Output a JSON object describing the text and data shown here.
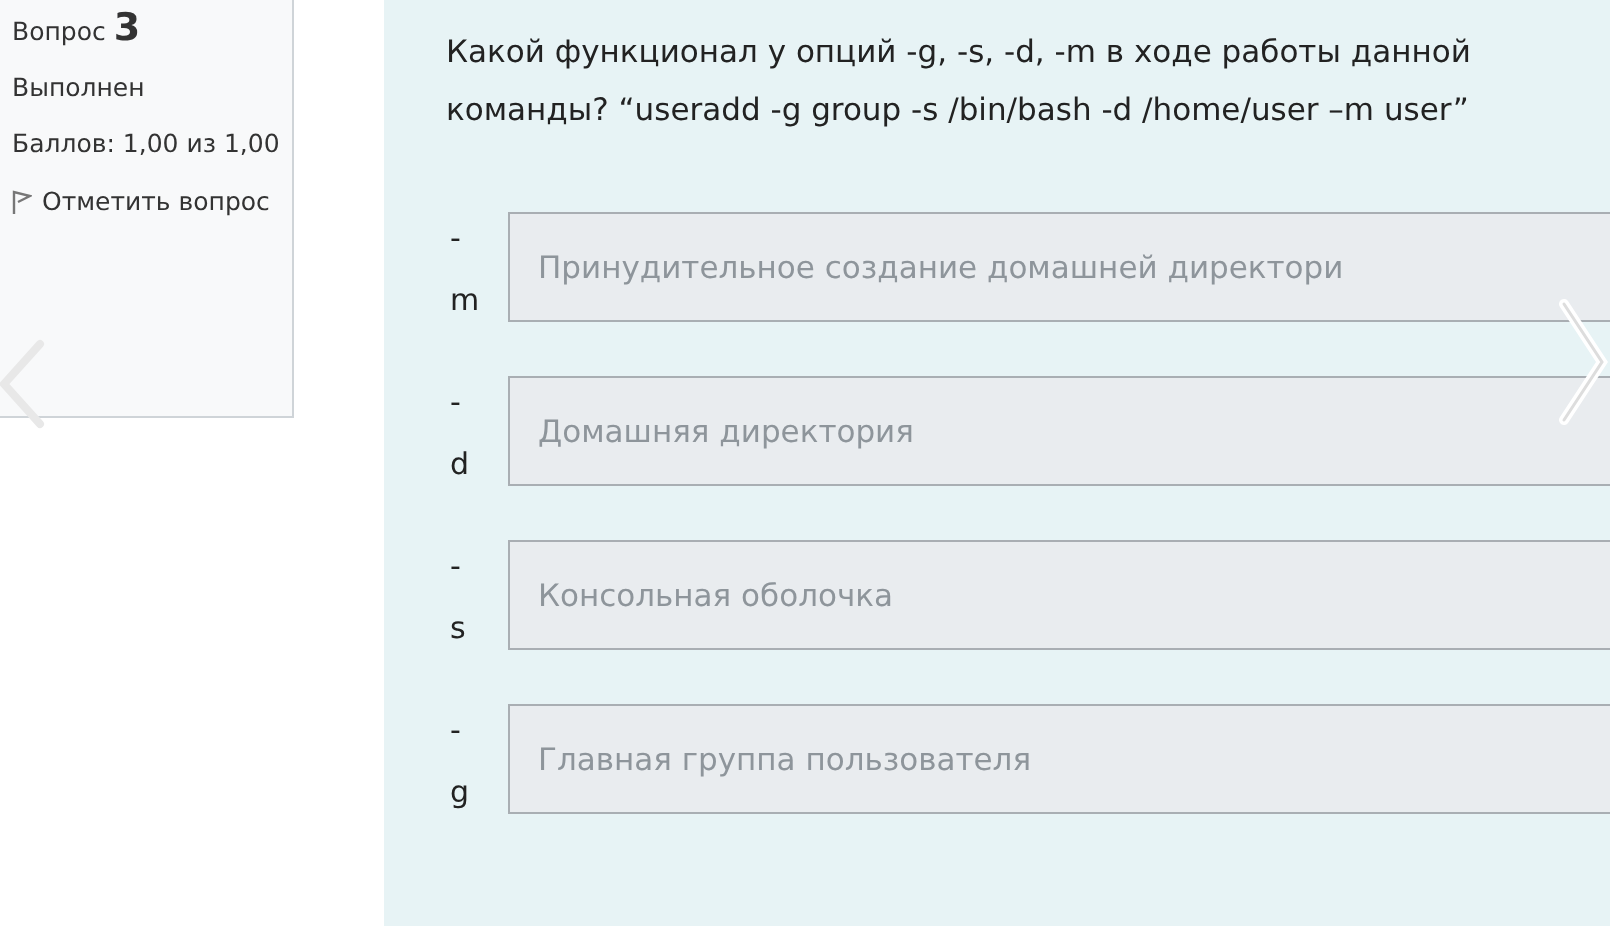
{
  "question_info": {
    "label": "Вопрос",
    "number": "3",
    "status": "Выполнен",
    "grade": "Баллов: 1,00 из 1,00",
    "flag_link": "Отметить вопрос"
  },
  "question_text": "Какой функционал у опций -g, -s, -d, -m в ходе работы данной команды?  “useradd -g group -s /bin/bash -d /home/user –m user”",
  "answers": [
    {
      "dash": "-",
      "option": "m",
      "value": "Принудительное создание домашней директори"
    },
    {
      "dash": "-",
      "option": "d",
      "value": "Домашняя директория"
    },
    {
      "dash": "-",
      "option": "s",
      "value": "Консольная оболочка"
    },
    {
      "dash": "-",
      "option": "g",
      "value": "Главная группа пользователя"
    }
  ]
}
